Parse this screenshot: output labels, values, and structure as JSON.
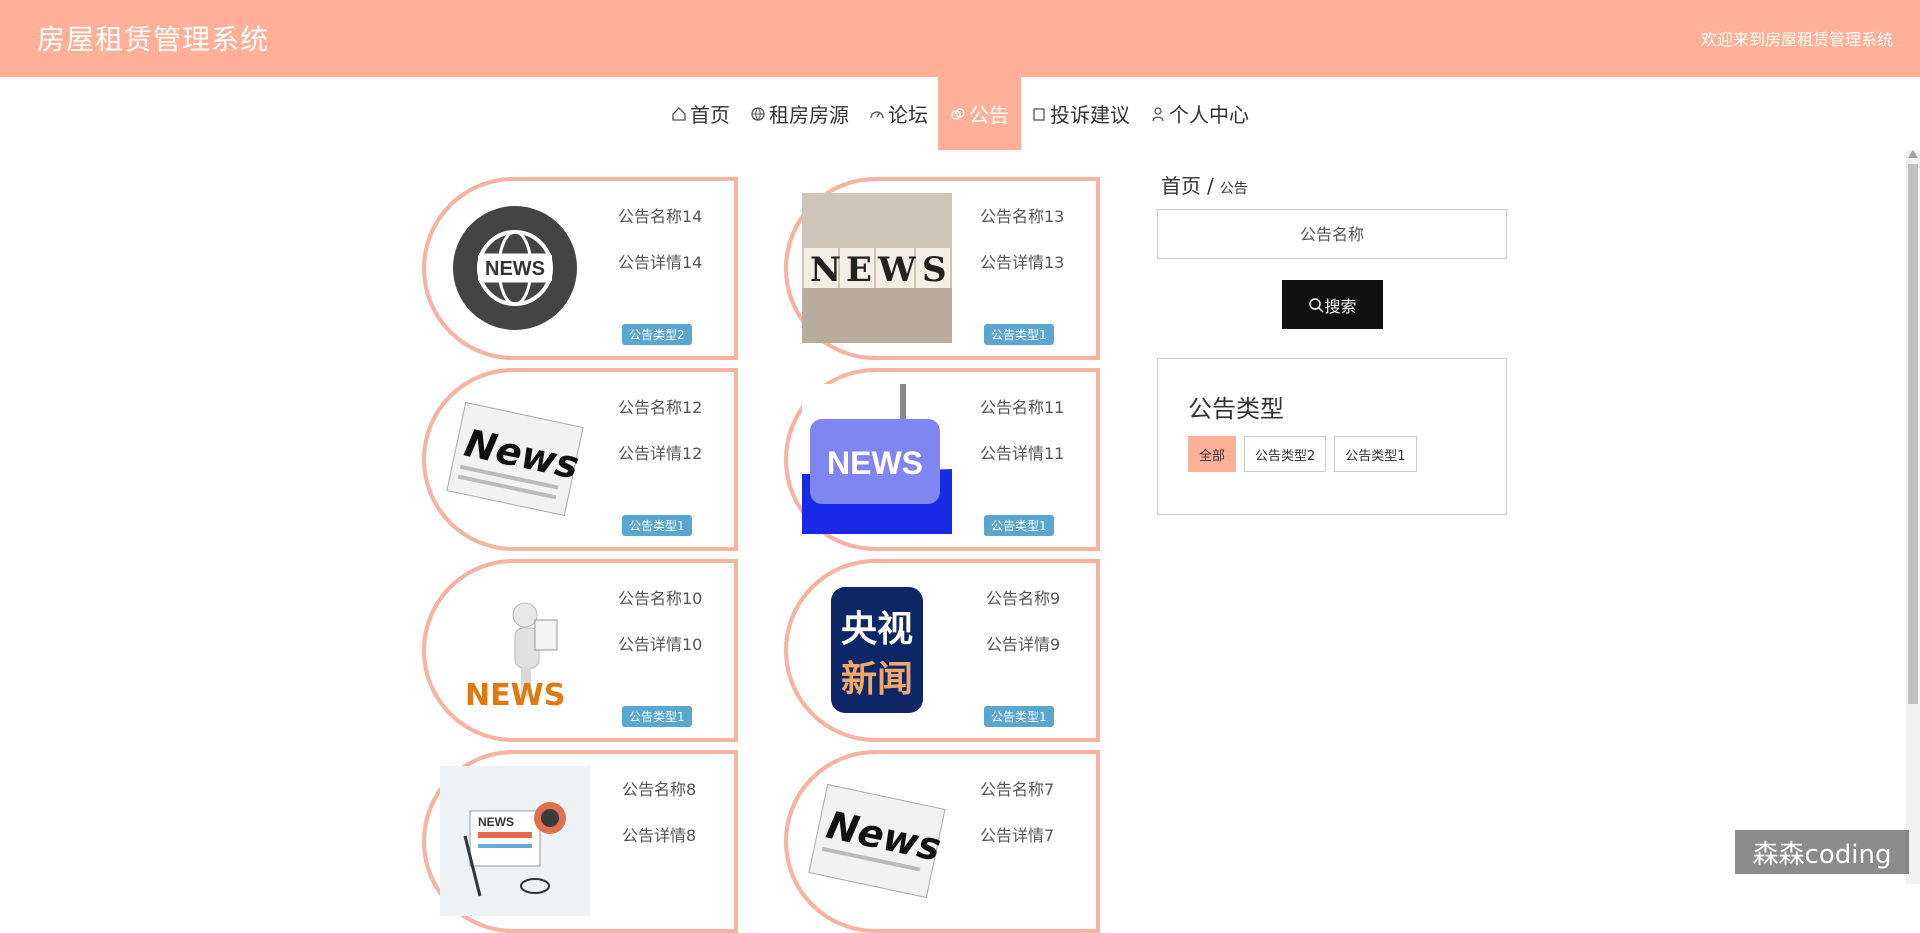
{
  "header": {
    "brand": "房屋租赁管理系统",
    "welcome": "欢迎来到房屋租赁管理系统",
    "accent_color": "#ffb096"
  },
  "nav": [
    {
      "label": "首页",
      "icon": "home-icon"
    },
    {
      "label": "租房房源",
      "icon": "globe-icon"
    },
    {
      "label": "论坛",
      "icon": "dashboard-icon"
    },
    {
      "label": "公告",
      "icon": "link-icon",
      "active": true
    },
    {
      "label": "投诉建议",
      "icon": "square-icon"
    },
    {
      "label": "个人中心",
      "icon": "user-icon"
    }
  ],
  "cards": [
    {
      "title": "公告名称14",
      "detail": "公告详情14",
      "type": "公告类型2",
      "image": "globe-news-icon"
    },
    {
      "title": "公告名称13",
      "detail": "公告详情13",
      "type": "公告类型1",
      "image": "news-dice-photo"
    },
    {
      "title": "公告名称12",
      "detail": "公告详情12",
      "type": "公告类型1",
      "image": "newspaper-icon"
    },
    {
      "title": "公告名称11",
      "detail": "公告详情11",
      "type": "公告类型1",
      "image": "news-keyboard-key"
    },
    {
      "title": "公告名称10",
      "detail": "公告详情10",
      "type": "公告类型1",
      "image": "reading-man-news"
    },
    {
      "title": "公告名称9",
      "detail": "公告详情9",
      "type": "公告类型1",
      "image": "cctv-news-logo"
    },
    {
      "title": "公告名称8",
      "detail": "公告详情8",
      "type": "",
      "image": "news-desk-illustration"
    },
    {
      "title": "公告名称7",
      "detail": "公告详情7",
      "type": "",
      "image": "newspaper-icon"
    }
  ],
  "sidebar": {
    "breadcrumb_home": "首页",
    "breadcrumb_sep": "/",
    "breadcrumb_current": "公告",
    "search_placeholder": "公告名称",
    "search_button": "搜索",
    "panel_title": "公告类型",
    "filters": [
      {
        "label": "全部",
        "active": true
      },
      {
        "label": "公告类型2"
      },
      {
        "label": "公告类型1"
      }
    ]
  },
  "watermark": "森森coding"
}
